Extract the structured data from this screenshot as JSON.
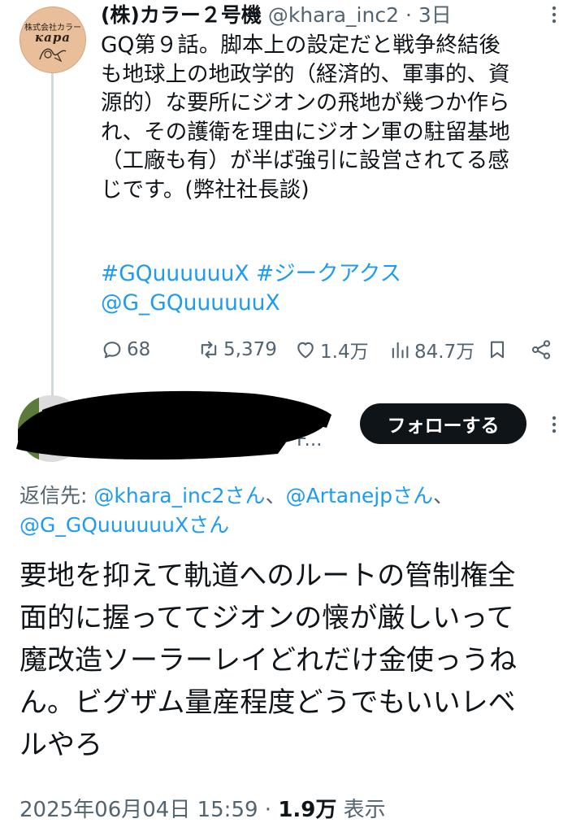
{
  "tweet1": {
    "author_name": "(株)カラー２号機",
    "author_handle": "@khara_inc2",
    "separator": "·",
    "time": "3日",
    "avatar": {
      "line1": "株式会社カラー",
      "line2": "кара"
    },
    "body_lines": [
      "GQ第９話。脚本上の設定だと戦争終結後",
      "も地球上の地政学的（経済的、軍事的、資",
      "源的）な要所にジオンの飛地が幾つか作ら",
      "れ、その護衛を理由にジオン軍の駐留基地",
      "（工廠も有）が半ば強引に設営されてる感",
      "じです。(弊社社長談)"
    ],
    "hashtags": [
      "#GQuuuuuuX",
      "#ジークアクス"
    ],
    "mention": "@G_GQuuuuuuX",
    "actions": {
      "reply_count": "68",
      "retweet_count": "5,379",
      "like_count": "1.4万",
      "view_count": "84.7万"
    }
  },
  "tweet2": {
    "author_name": "",
    "author_handle": "F...",
    "follow_label": "フォローする",
    "reply_to_prefix": "返信先: ",
    "reply_to_mentions": [
      "@khara_inc2さん",
      "@Artanejpさん",
      "@G_GQuuuuuuXさん"
    ],
    "reply_to_separator": "、",
    "body_lines": [
      "要地を抑えて軌道へのルートの管制権全",
      "面的に握っててジオンの懐が厳しいって",
      "魔改造ソーラーレイどれだけ金使っうね",
      "ん。ビグザム量産程度どうでもいいレベ",
      "ルやろ"
    ],
    "datetime": "2025年06月04日 15:59",
    "meta_separator": " · ",
    "views": "1.9万",
    "views_label": "表示"
  },
  "colors": {
    "accent": "#1d9bf0",
    "text": "#0f1419",
    "muted": "#536471",
    "divider": "#cfd9de"
  }
}
